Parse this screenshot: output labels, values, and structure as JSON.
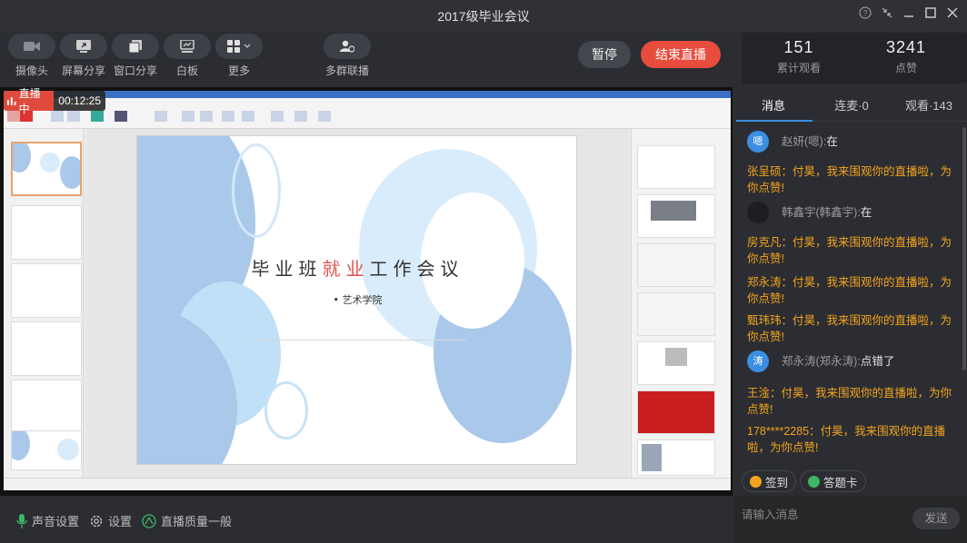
{
  "window": {
    "title": "2017级毕业会议"
  },
  "toolbar": {
    "camera_label": "摄像头",
    "screen_share_label": "屏幕分享",
    "window_share_label": "窗口分享",
    "whiteboard_label": "白板",
    "more_label": "更多",
    "multi_group_label": "多群联播",
    "pause_label": "暂停",
    "end_live_label": "结束直播"
  },
  "live": {
    "badge": "直播中",
    "elapsed": "00:12:25"
  },
  "slide": {
    "title_part1": "毕业班",
    "title_highlight": "就业",
    "title_part2": "工作会议",
    "subtitle": "• 艺术学院"
  },
  "bottom": {
    "audio_settings": "声音设置",
    "settings": "设置",
    "quality": "直播质量一般"
  },
  "stats": {
    "viewers": "151",
    "viewers_label": "累计观看",
    "likes": "3241",
    "likes_label": "点赞"
  },
  "tabs": {
    "messages": "消息",
    "mic": "连麦·0",
    "watching": "观看·143"
  },
  "chat": [
    {
      "type": "user",
      "avatar": "嗯",
      "name": "赵妍(嗯):",
      "text": "在"
    },
    {
      "type": "sys",
      "text": "张呈硕：付昊，我来围观你的直播啦，为你点赞!"
    },
    {
      "type": "user",
      "avatar": "",
      "name": "韩鑫宇(韩鑫宇):",
      "text": "在"
    },
    {
      "type": "sys",
      "text": "房克凡：付昊，我来围观你的直播啦，为你点赞!"
    },
    {
      "type": "sys",
      "text": "郑永涛：付昊，我来围观你的直播啦，为你点赞!"
    },
    {
      "type": "sys",
      "text": "甄玮玮：付昊，我来围观你的直播啦，为你点赞!"
    },
    {
      "type": "user",
      "avatar": "涛",
      "name": "郑永涛(郑永涛):",
      "text": "点错了"
    },
    {
      "type": "sys",
      "text": "王淦：付昊，我来围观你的直播啦，为你点赞!"
    },
    {
      "type": "sys",
      "text": "178****2285：付昊，我来围观你的直播啦，为你点赞!"
    }
  ],
  "quick": {
    "checkin": "签到",
    "answer_card": "答题卡"
  },
  "input": {
    "placeholder": "请输入消息",
    "send": "发送"
  },
  "colors": {
    "accent": "#3b8fe0",
    "end": "#e84c3d",
    "system_msg": "#f3a41e"
  }
}
